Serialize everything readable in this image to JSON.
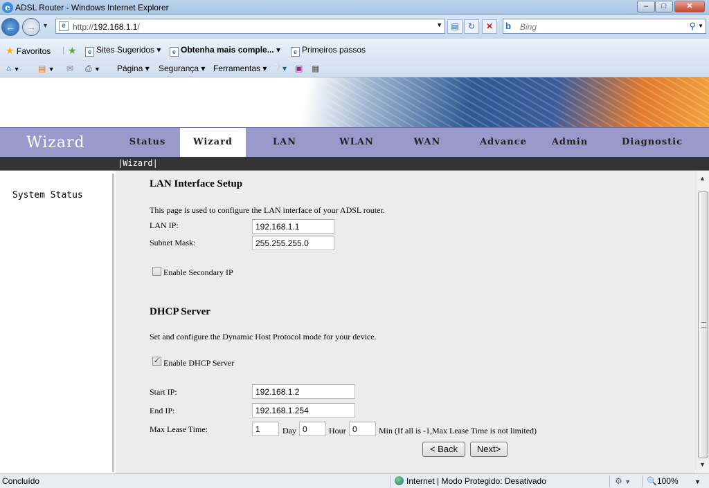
{
  "window": {
    "title": "ADSL Router - Windows Internet Explorer",
    "min": "–",
    "max": "□",
    "close": "✕"
  },
  "addressbar": {
    "url_prefix": "http://",
    "url_host": "192.168.1.1",
    "url_suffix": "/",
    "search_placeholder": "Bing"
  },
  "favorites_bar": {
    "favorites": "Favoritos",
    "suggested_sites": "Sites Sugeridos",
    "get_more": "Obtenha mais comple...",
    "first_steps": "Primeiros passos"
  },
  "command_bar": {
    "page": "Página",
    "security": "Segurança",
    "tools": "Ferramentas"
  },
  "router": {
    "logo": "Wizard",
    "tabs": [
      "Status",
      "Wizard",
      "LAN",
      "WLAN",
      "WAN",
      "Advance",
      "Admin",
      "Diagnostic"
    ],
    "active_tab": "Wizard",
    "subnav": "|Wizard|",
    "sidebar": [
      "System Status"
    ]
  },
  "lan": {
    "title": "LAN Interface Setup",
    "description": "This page is used to configure the LAN interface of your ADSL router.",
    "ip_label": "LAN IP:",
    "ip_value": "192.168.1.1",
    "mask_label": "Subnet Mask:",
    "mask_value": "255.255.255.0",
    "secondary_label": "Enable Secondary IP",
    "secondary_checked": false
  },
  "dhcp": {
    "title": "DHCP Server",
    "description": "Set and configure the Dynamic Host Protocol mode for your device.",
    "enable_label": "Enable DHCP Server",
    "enable_checked": true,
    "start_label": "Start IP:",
    "start_value": "192.168.1.2",
    "end_label": "End IP:",
    "end_value": "192.168.1.254",
    "lease_label": "Max Lease Time:",
    "lease_day": "1",
    "day_unit": "Day",
    "lease_hour": "0",
    "hour_unit": "Hour",
    "lease_min": "0",
    "min_note": "Min (If all is -1,Max Lease Time is not limited)"
  },
  "buttons": {
    "back": "< Back",
    "next": "Next>"
  },
  "statusbar": {
    "status": "Concluído",
    "zone": "Internet | Modo Protegido: Desativado",
    "zoom": "100%"
  }
}
